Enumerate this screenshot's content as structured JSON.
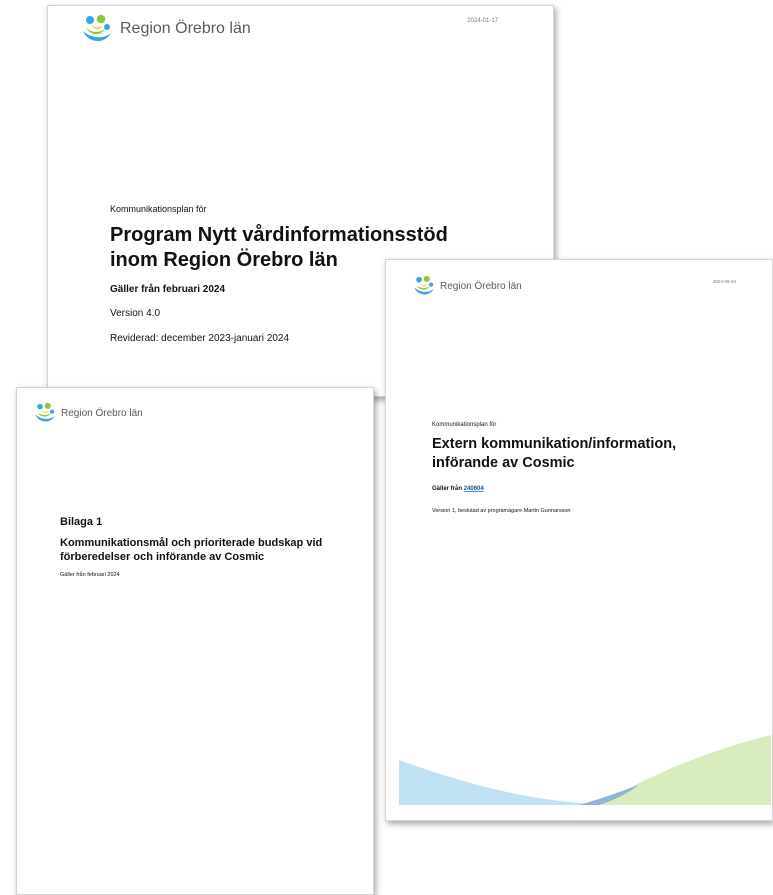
{
  "brand": {
    "name": "Region Örebro län",
    "colors": {
      "blue": "#3aa6dd",
      "green": "#8cc63f",
      "yellow": "#f5c400",
      "navy": "#1f4e8c"
    }
  },
  "doc1": {
    "date": "2024-01-17",
    "kicker": "Kommunikationsplan för",
    "title_line1": "Program Nytt vårdinformationsstöd",
    "title_line2": "inom Region Örebro län",
    "valid_from": "Gäller från februari 2024",
    "version": "Version 4.0",
    "revised": "Reviderad: december 2023-januari 2024"
  },
  "doc2": {
    "heading": "Bilaga 1",
    "title_line1": "Kommunikationsmål och prioriterade budskap vid",
    "title_line2": "förberedelser och införande av Cosmic",
    "valid_from": "Gäller från februari 2024"
  },
  "doc3": {
    "date": "2024-06-04",
    "kicker": "Kommunikationsplan för",
    "title_line1": "Extern kommunikation/information,",
    "title_line2": "införande av Cosmic",
    "valid_prefix": "Gäller från",
    "valid_date": "240604",
    "version": "Version 1, beslutad av programägare Martin Gunnarsson"
  }
}
